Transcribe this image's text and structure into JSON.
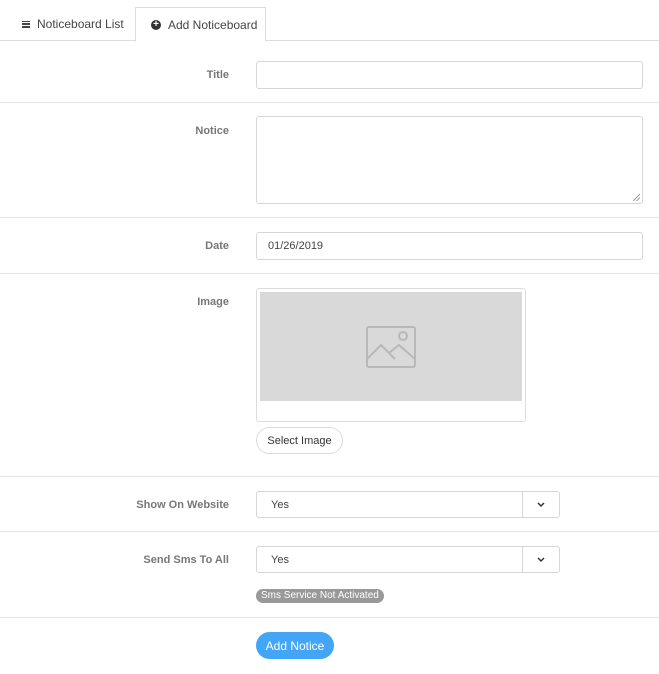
{
  "tabs": {
    "list_label": "Noticeboard List",
    "add_label": "Add Noticeboard"
  },
  "form": {
    "title_label": "Title",
    "title_value": "",
    "notice_label": "Notice",
    "notice_value": "",
    "date_label": "Date",
    "date_value": "01/26/2019",
    "image_label": "Image",
    "select_image_label": "Select Image",
    "show_on_website_label": "Show On Website",
    "show_on_website_value": "Yes",
    "send_sms_label": "Send Sms To All",
    "send_sms_value": "Yes",
    "sms_status_badge": "Sms Service Not Activated",
    "submit_label": "Add Notice"
  },
  "icons": {
    "list_tab": "list-icon",
    "add_tab": "plus-circle-icon",
    "image_placeholder": "image-icon",
    "select_caret": "chevron-down-icon"
  },
  "colors": {
    "accent": "#42a5f5",
    "badge": "#999999",
    "placeholder_bg": "#d9d9d9"
  }
}
